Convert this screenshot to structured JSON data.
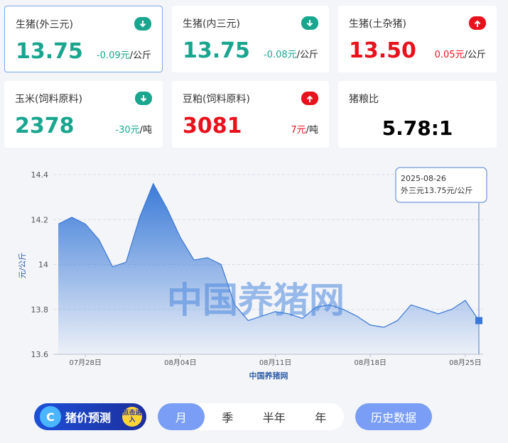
{
  "cards": [
    {
      "name": "生猪(外三元)",
      "price": "13.75",
      "change": "-0.09元",
      "unit": "/公斤",
      "trend": "down"
    },
    {
      "name": "生猪(内三元)",
      "price": "13.75",
      "change": "-0.08元",
      "unit": "/公斤",
      "trend": "down"
    },
    {
      "name": "生猪(土杂猪)",
      "price": "13.50",
      "change": "0.05元",
      "unit": "/公斤",
      "trend": "up"
    },
    {
      "name": "玉米(饲料原料)",
      "price": "2378",
      "change": "-30元",
      "unit": "/吨",
      "trend": "down"
    },
    {
      "name": "豆粕(饲料原料)",
      "price": "3081",
      "change": "7元",
      "unit": "/吨",
      "trend": "up"
    },
    {
      "name": "猪粮比",
      "value": "5.78:1"
    }
  ],
  "colors": {
    "down": "#1aa58e",
    "up": "#e8121c",
    "accent": "#7a9ef5",
    "line": "#3a78d4"
  },
  "chart_data": {
    "type": "area",
    "ylabel": "元/公斤",
    "xlabel": "中国养猪网",
    "watermark": "中国养猪网",
    "ylim": [
      13.6,
      14.4
    ],
    "yticks": [
      "14.4",
      "14.2",
      "14",
      "13.8",
      "13.6"
    ],
    "ytick_values": [
      14.4,
      14.2,
      14.0,
      13.8,
      13.6
    ],
    "xtick_labels": [
      "07月28日",
      "08月04日",
      "08月11日",
      "08月18日",
      "08月25日"
    ],
    "xtick_index": [
      2,
      9,
      16,
      23,
      30
    ],
    "x": [
      "07-26",
      "07-27",
      "07-28",
      "07-29",
      "07-30",
      "07-31",
      "08-01",
      "08-02",
      "08-03",
      "08-04",
      "08-05",
      "08-06",
      "08-07",
      "08-08",
      "08-09",
      "08-10",
      "08-11",
      "08-12",
      "08-13",
      "08-14",
      "08-15",
      "08-16",
      "08-17",
      "08-18",
      "08-19",
      "08-20",
      "08-21",
      "08-22",
      "08-23",
      "08-24",
      "08-25",
      "08-26"
    ],
    "series": [
      {
        "name": "外三元",
        "values": [
          14.18,
          14.21,
          14.18,
          14.11,
          13.99,
          14.01,
          14.21,
          14.36,
          14.25,
          14.12,
          14.02,
          14.03,
          14.0,
          13.82,
          13.75,
          13.77,
          13.79,
          13.78,
          13.76,
          13.81,
          13.82,
          13.8,
          13.77,
          13.73,
          13.72,
          13.75,
          13.82,
          13.8,
          13.78,
          13.8,
          13.84,
          13.75
        ]
      }
    ],
    "tooltip": {
      "date": "2025-08-26",
      "label": "外三元13.75元/公斤"
    }
  },
  "controls": {
    "promo_text": "猪价预测",
    "promo_badge": "点击进入",
    "periods": [
      "月",
      "季",
      "半年",
      "年"
    ],
    "active_period": "月",
    "history": "历史数据"
  }
}
